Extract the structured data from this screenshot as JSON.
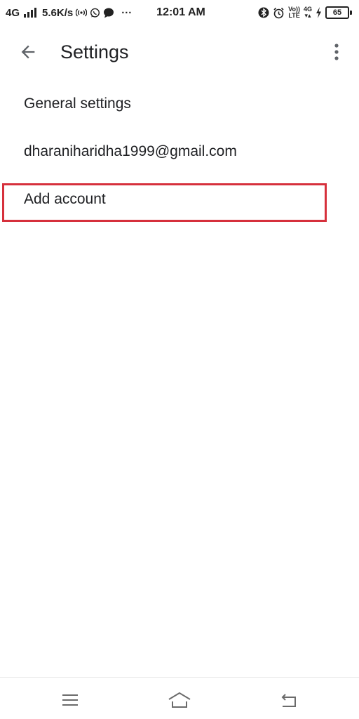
{
  "status_bar": {
    "network": "4G",
    "speed": "5.6K/s",
    "dots": "···",
    "time": "12:01 AM",
    "volte_top": "Vo))",
    "volte_bottom": "LTE",
    "net_right_top": "4G",
    "net_right_bottom": "▾▴",
    "battery_level": "65",
    "icons_left": [
      "signal-bars-icon",
      "hotspot-icon",
      "whatsapp-icon",
      "message-bubble-icon"
    ],
    "icons_right": [
      "bluetooth-icon",
      "alarm-icon",
      "volte-icon",
      "charging-icon",
      "battery-icon"
    ]
  },
  "app_bar": {
    "title": "Settings",
    "back_icon": "arrow-back-icon",
    "overflow_icon": "more-vert-icon"
  },
  "settings_list": {
    "items": [
      {
        "label": "General settings"
      },
      {
        "label": "dharaniharidha1999@gmail.com"
      },
      {
        "label": "Add account"
      }
    ]
  },
  "highlight": {
    "color": "#d6303c",
    "target": "Add account"
  },
  "nav_bar": {
    "icons": [
      "menu-icon",
      "home-icon",
      "back-return-icon"
    ]
  }
}
